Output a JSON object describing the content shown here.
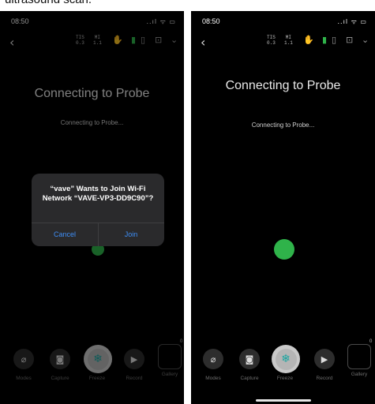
{
  "caption": "ultrasound scan.",
  "screens": [
    {
      "status": {
        "time": "08:50",
        "icons": "..ıl ᯤ ▭"
      },
      "toolbar": {
        "back": "‹",
        "tis_label": "TIS",
        "tis_value": "0.3",
        "mi_label": "MI",
        "mi_value": "1.1"
      },
      "title": "Connecting to Probe",
      "subtitle": "Connecting to Probe...",
      "alert": {
        "title": "“vave” Wants to Join Wi-Fi Network “VAVE-VP3-DD9C90”?",
        "cancel": "Cancel",
        "join": "Join"
      },
      "bottom": {
        "modes": "Modes",
        "capture": "Capture",
        "freeze": "Freeze",
        "record": "Record",
        "gallery": "Gallery",
        "gallery_count": "0"
      }
    },
    {
      "status": {
        "time": "08:50",
        "icons": "..ıl ᯤ ▭"
      },
      "toolbar": {
        "back": "‹",
        "tis_label": "TIS",
        "tis_value": "0.3",
        "mi_label": "MI",
        "mi_value": "1.1"
      },
      "title": "Connecting to Probe",
      "subtitle": "Connecting to Probe...",
      "bottom": {
        "modes": "Modes",
        "capture": "Capture",
        "freeze": "Freeze",
        "record": "Record",
        "gallery": "Gallery",
        "gallery_count": "0"
      }
    }
  ],
  "icons": {
    "hand": "hand-icon",
    "battery": "battery-icon",
    "probe": "probe-icon",
    "person": "person-box-icon",
    "chevron": "chevron-down-icon",
    "modes": "eye-slash-icon",
    "capture": "camera-icon",
    "freeze": "snowflake-icon",
    "record": "video-camera-icon"
  },
  "colors": {
    "background": "#000000",
    "probe_dot": "#2fb34a",
    "alert_bg": "#2a2a2c",
    "alert_link": "#3e8ef7",
    "freeze_accent": "#1aa5a0"
  }
}
